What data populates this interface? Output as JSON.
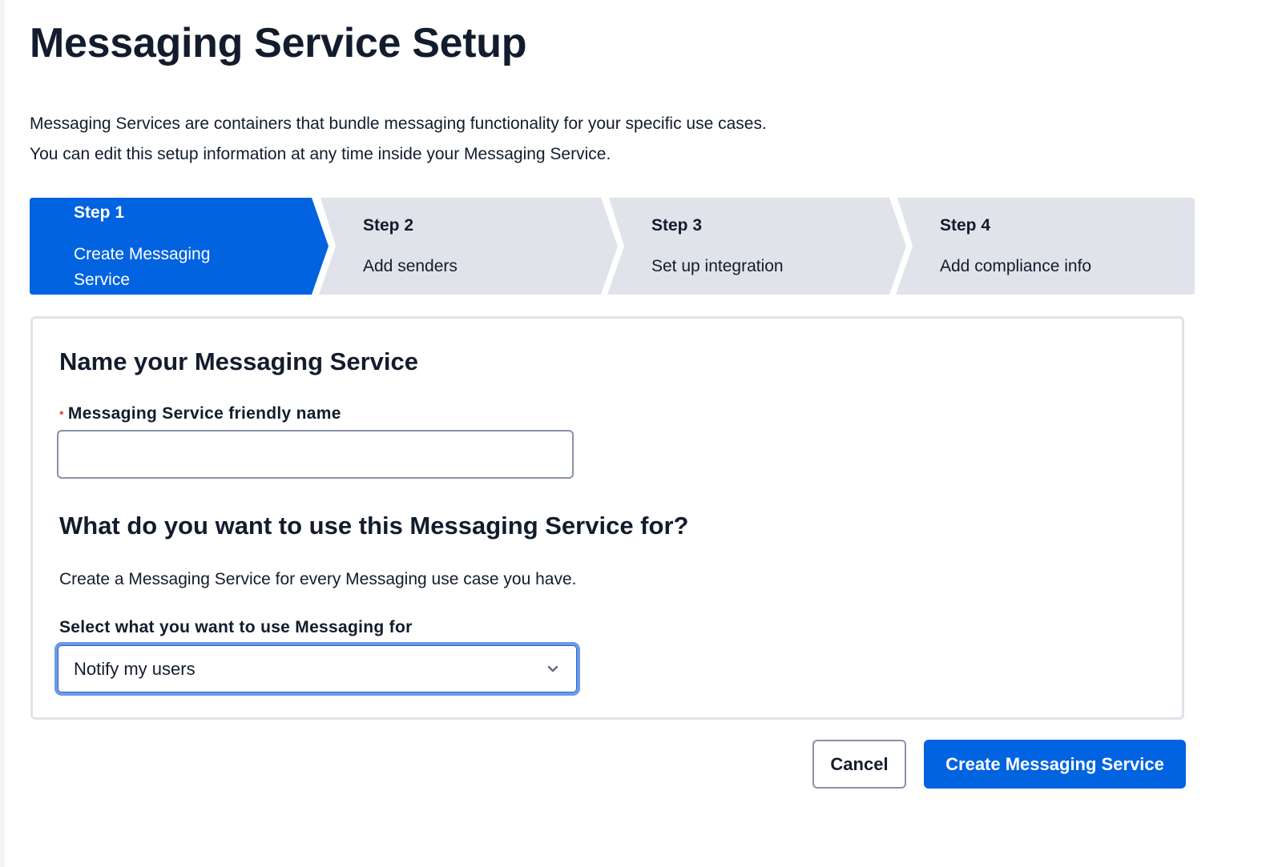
{
  "page": {
    "title": "Messaging Service Setup",
    "intro_lines": [
      "Messaging Services are containers that bundle messaging functionality for your specific use cases.",
      "You can edit this setup information at any time inside your Messaging Service."
    ]
  },
  "stepper": {
    "active_index": 0,
    "colors": {
      "active": "#0263e0",
      "inactive": "#e1e3ea"
    },
    "steps": [
      {
        "number": "Step 1",
        "label_lines": [
          "Create Messaging",
          "Service"
        ]
      },
      {
        "number": "Step 2",
        "label_lines": [
          "Add senders"
        ]
      },
      {
        "number": "Step 3",
        "label_lines": [
          "Set up integration"
        ]
      },
      {
        "number": "Step 4",
        "label_lines": [
          "Add compliance info"
        ]
      }
    ]
  },
  "form": {
    "name_section_title": "Name your Messaging Service",
    "friendly_name": {
      "required_marker": "•",
      "label": "Messaging Service friendly name",
      "value": "",
      "placeholder": ""
    },
    "use_section_title": "What do you want to use this Messaging Service for?",
    "use_help_text": "Create a Messaging Service for every Messaging use case you have.",
    "use_select": {
      "label": "Select what you want to use Messaging for",
      "selected": "Notify my users",
      "icon": "chevron-down-icon"
    }
  },
  "actions": {
    "cancel_label": "Cancel",
    "create_label": "Create Messaging Service"
  }
}
